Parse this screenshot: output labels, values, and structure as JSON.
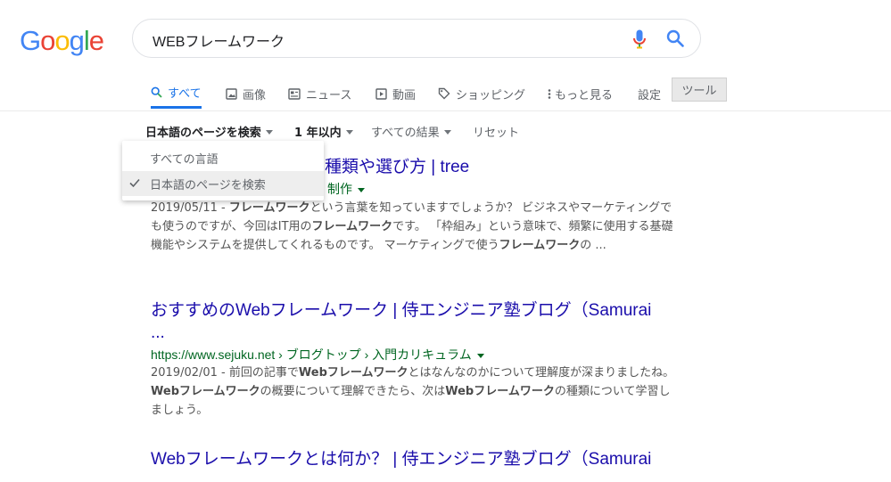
{
  "logo": {
    "letters": [
      "G",
      "o",
      "o",
      "g",
      "l",
      "e"
    ],
    "colors": [
      "#4285f4",
      "#ea4335",
      "#fbbc05",
      "#4285f4",
      "#34a853",
      "#ea4335"
    ]
  },
  "search": {
    "query": "WEBフレームワーク"
  },
  "tabs": [
    {
      "label": "すべて",
      "icon": "search-icon"
    },
    {
      "label": "画像",
      "icon": "image-icon"
    },
    {
      "label": "ニュース",
      "icon": "news-icon"
    },
    {
      "label": "動画",
      "icon": "video-icon"
    },
    {
      "label": "ショッピング",
      "icon": "tag-icon"
    },
    {
      "label": "もっと見る",
      "icon": "more-vert-icon"
    },
    {
      "label": "設定"
    },
    {
      "label": "ツール"
    }
  ],
  "filters": {
    "language": "日本語のページを検索",
    "time": "1 年以内",
    "results": "すべての結果",
    "reset": "リセット"
  },
  "dropdown": {
    "items": [
      "すべての言語",
      "日本語のページを検索"
    ],
    "selected_index": 1
  },
  "results": [
    {
      "title": "の種類や選び方 | tree",
      "url": "制作",
      "date": "2019/05/11 - ",
      "snippet_parts": [
        {
          "b": true,
          "t": "フレームワーク"
        },
        {
          "b": false,
          "t": "という言葉を知っていますでしょうか？ ビジネスやマーケティングでも使うのですが、今回はIT用の"
        },
        {
          "b": true,
          "t": "フレームワーク"
        },
        {
          "b": false,
          "t": "です。 「枠組み」という意味で、頻繁に使用する基礎機能やシステムを提供してくれるものです。 マーケティングで使う"
        },
        {
          "b": true,
          "t": "フレームワーク"
        },
        {
          "b": false,
          "t": "の ..."
        }
      ]
    },
    {
      "title_line1": "おすすめのWebフレームワーク | 侍エンジニア塾ブログ（Samurai",
      "title_line2": "...",
      "url": "https://www.sejuku.net › ブログトップ › 入門カリキュラム",
      "date": "2019/02/01 - ",
      "snippet_parts": [
        {
          "b": false,
          "t": "前回の記事で"
        },
        {
          "b": true,
          "t": "Webフレームワーク"
        },
        {
          "b": false,
          "t": "とはなんなのかについて理解度が深まりましたね。"
        },
        {
          "b": true,
          "t": "Webフレームワーク"
        },
        {
          "b": false,
          "t": "の概要について理解できたら、次は"
        },
        {
          "b": true,
          "t": "Webフレームワーク"
        },
        {
          "b": false,
          "t": "の種類について学習しましょう。"
        }
      ]
    },
    {
      "title": "Webフレームワークとは何か？ | 侍エンジニア塾ブログ（Samurai"
    }
  ]
}
